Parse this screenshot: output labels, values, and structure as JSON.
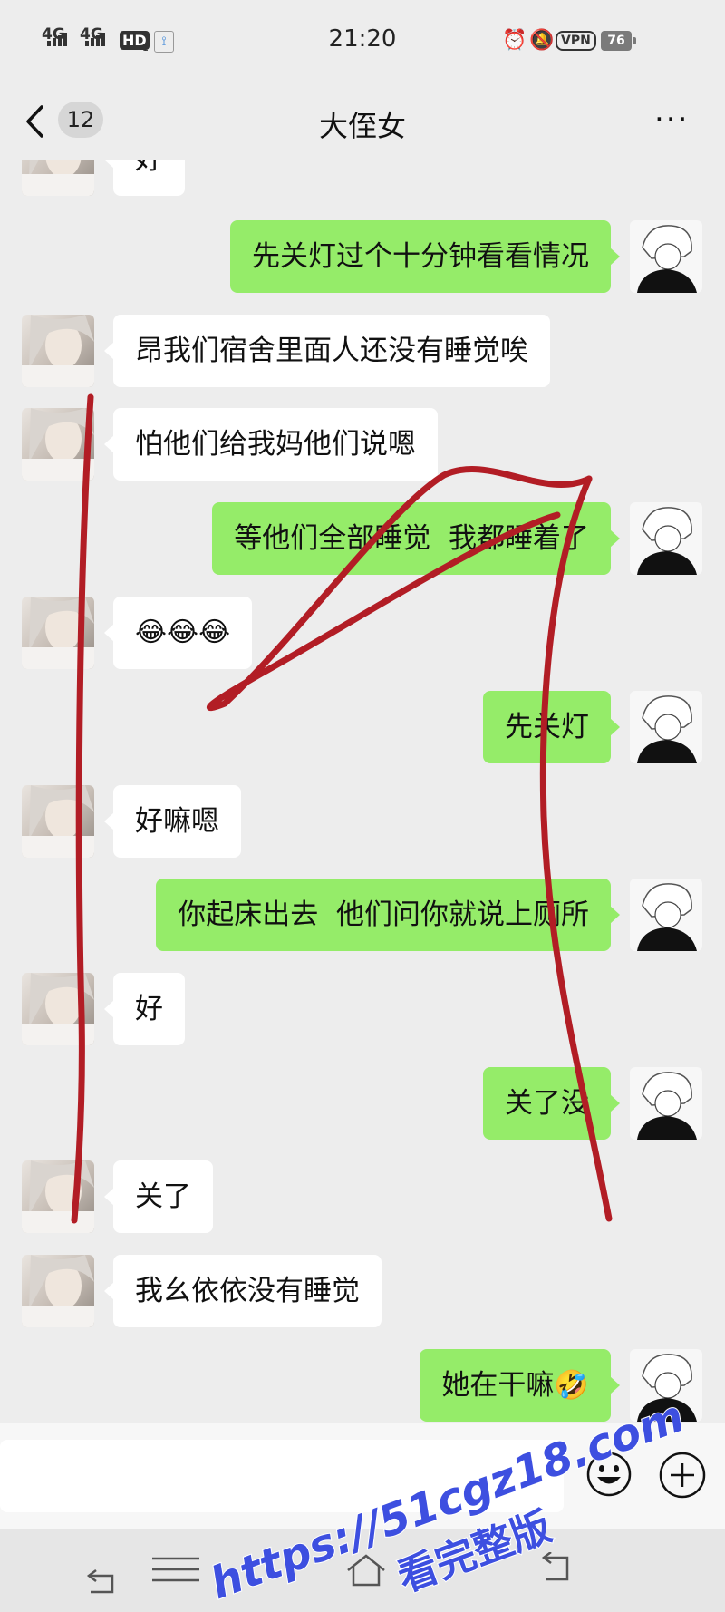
{
  "status_bar": {
    "signal_1": "4G",
    "signal_2": "4G",
    "hd": "HD",
    "hd_sub": "1",
    "time": "21:20",
    "vpn": "VPN",
    "battery": "76",
    "icons": [
      "alarm-icon",
      "mute-bell-icon"
    ]
  },
  "nav": {
    "unread_count": "12",
    "title": "大侄女"
  },
  "messages": [
    {
      "side": "in",
      "text": "好"
    },
    {
      "side": "out",
      "text": "先关灯过个十分钟看看情况"
    },
    {
      "side": "in",
      "text": "昂我们宿舍里面人还没有睡觉唉"
    },
    {
      "side": "in",
      "text": "怕他们给我妈他们说嗯"
    },
    {
      "side": "out",
      "text": "等他们全部睡觉  我都睡着了"
    },
    {
      "side": "in",
      "text": "😂😂😂"
    },
    {
      "side": "out",
      "text": "先关灯"
    },
    {
      "side": "in",
      "text": "好嘛嗯"
    },
    {
      "side": "out",
      "text": "你起床出去  他们问你就说上厕所"
    },
    {
      "side": "in",
      "text": "好"
    },
    {
      "side": "out",
      "text": "关了没"
    },
    {
      "side": "in",
      "text": "关了"
    },
    {
      "side": "in",
      "text": "我幺依依没有睡觉"
    },
    {
      "side": "out",
      "text": "她在干嘛🤣"
    }
  ],
  "input": {
    "placeholder": ""
  },
  "watermark": {
    "line1": "https://51cgz18.com",
    "line2": "看完整版"
  },
  "colors": {
    "outgoing_bubble": "#95ec69",
    "incoming_bubble": "#ffffff",
    "background": "#ededed",
    "scribble": "#b21d25",
    "watermark": "#3d4fe0"
  }
}
